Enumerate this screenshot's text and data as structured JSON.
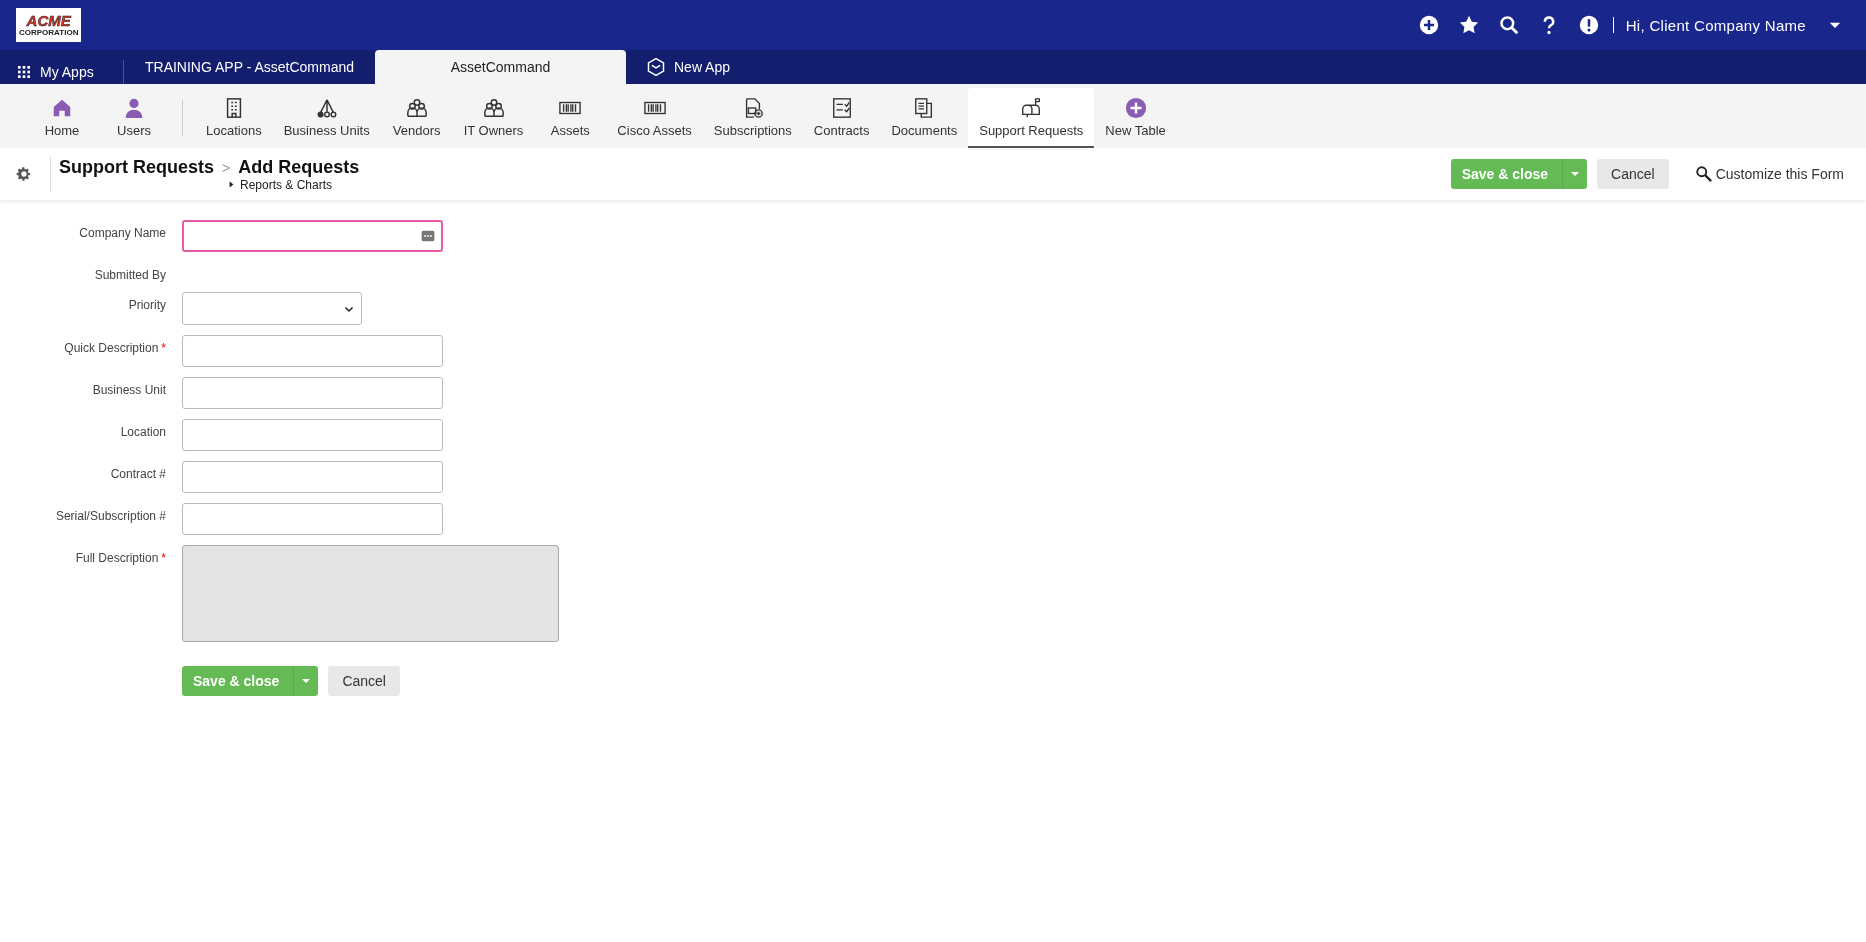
{
  "top_bar": {
    "logo": "ACME",
    "logo_sub": "CORPORATION",
    "greeting": "Hi, Client Company Name"
  },
  "app_tabs": [
    {
      "label": "My Apps",
      "selected": false
    },
    {
      "label": "TRAINING APP - AssetCommand",
      "selected": false
    },
    {
      "label": "AssetCommand",
      "selected": true
    },
    {
      "label": "New App",
      "selected": false
    }
  ],
  "nav": [
    {
      "label": "Home",
      "selected": false
    },
    {
      "label": "Users",
      "selected": false
    },
    {
      "label": "Locations",
      "selected": false
    },
    {
      "label": "Business Units",
      "selected": false
    },
    {
      "label": "Vendors",
      "selected": false
    },
    {
      "label": "IT Owners",
      "selected": false
    },
    {
      "label": "Assets",
      "selected": false
    },
    {
      "label": "Cisco Assets",
      "selected": false
    },
    {
      "label": "Subscriptions",
      "selected": false
    },
    {
      "label": "Contracts",
      "selected": false
    },
    {
      "label": "Documents",
      "selected": false
    },
    {
      "label": "Support Requests",
      "selected": true
    },
    {
      "label": "New Table",
      "selected": false
    }
  ],
  "header": {
    "breadcrumb": [
      "Support Requests",
      "Add Requests"
    ],
    "separator": ">",
    "sublink": "Reports & Charts",
    "save": "Save & close",
    "cancel": "Cancel",
    "customize": "Customize this Form"
  },
  "form": {
    "fields": [
      {
        "label": "Company Name",
        "kind": "lookup",
        "required": false,
        "focused": true,
        "disabled": false
      },
      {
        "label": "Submitted By",
        "kind": "static",
        "required": false
      },
      {
        "label": "Priority",
        "kind": "select",
        "required": false,
        "focused": false,
        "disabled": false
      },
      {
        "label": "Quick Description",
        "kind": "text",
        "required": true,
        "focused": false,
        "disabled": false
      },
      {
        "label": "Business Unit",
        "kind": "text",
        "required": false,
        "focused": false,
        "disabled": false
      },
      {
        "label": "Location",
        "kind": "text",
        "required": false,
        "focused": false,
        "disabled": false
      },
      {
        "label": "Contract #",
        "kind": "text",
        "required": false,
        "focused": false,
        "disabled": false
      },
      {
        "label": "Serial/Subscription #",
        "kind": "text",
        "required": false,
        "focused": false,
        "disabled": false
      },
      {
        "label": "Full Description",
        "kind": "textarea",
        "required": true,
        "focused": false,
        "disabled": true
      }
    ],
    "required_mark": "*",
    "save": "Save & close",
    "cancel": "Cancel"
  }
}
